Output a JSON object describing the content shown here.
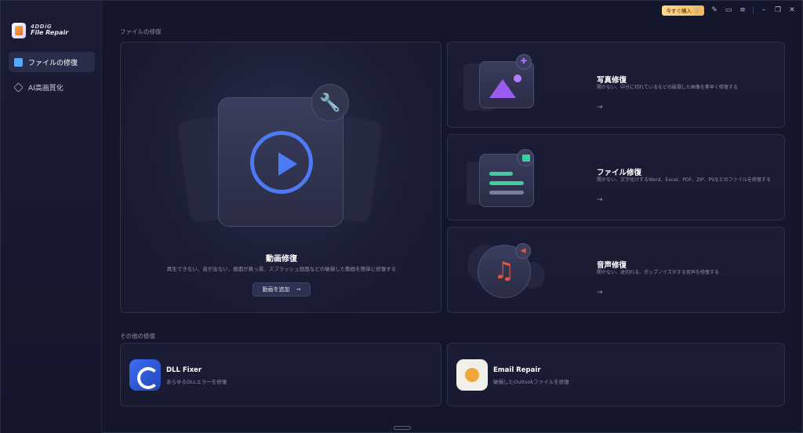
{
  "app": {
    "brand": "4DDiG",
    "product": "File Repair"
  },
  "sidebar": {
    "items": [
      {
        "label": "ファイルの修復",
        "icon": "file-repair-icon",
        "active": true
      },
      {
        "label": "AI高画質化",
        "icon": "ai-enhance-icon",
        "active": false
      }
    ]
  },
  "topbar": {
    "buy_label": "今すぐ購入"
  },
  "sections": {
    "repair_title": "ファイルの修復",
    "other_title": "その他の修復"
  },
  "video_card": {
    "title": "動画修復",
    "description": "再生できない、音が出ない、画面が真っ黒、スプラッシュ画面などの破損した動画を簡単に修復する",
    "button": "動画を追加",
    "arrow": "→"
  },
  "right_cards": [
    {
      "title": "写真修復",
      "description": "開かない、中分に切れているなどの破損した画像を素早く修復する",
      "arrow": "→"
    },
    {
      "title": "ファイル修復",
      "description": "開かない、文字化けするWord、Excel、PDF、ZIP、PSなどのファイルを修復する",
      "arrow": "→"
    },
    {
      "title": "音声修復",
      "description": "開かない、途切れる、ポップノイズがする音声を修復する",
      "arrow": "→"
    }
  ],
  "other_cards": [
    {
      "title": "DLL Fixer",
      "description": "あらゆるDLLエラーを修復",
      "icon": "dll-fixer-icon"
    },
    {
      "title": "Email Repair",
      "description": "破損したOutlookファイルを修復",
      "icon": "email-repair-icon"
    }
  ],
  "colors": {
    "accent_blue": "#4d7bf5",
    "photo_purple": "#9b5cf0",
    "file_green": "#3ecf9e",
    "audio_red": "#e0573b",
    "buy_gold": "#f4b95c"
  }
}
